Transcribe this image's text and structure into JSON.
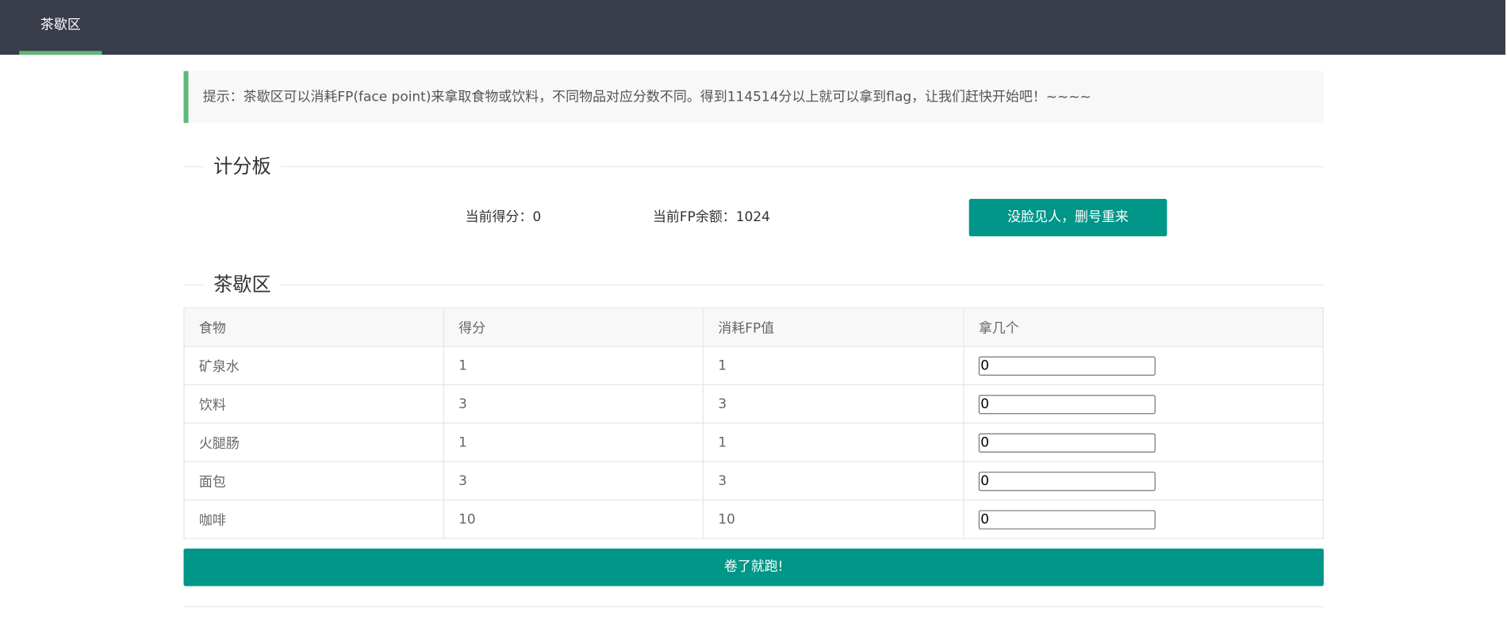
{
  "nav": {
    "active_label": "茶歇区"
  },
  "tip": {
    "text": "提示：茶歇区可以消耗FP(face point)来拿取食物或饮料，不同物品对应分数不同。得到114514分以上就可以拿到flag，让我们赶快开始吧！~~~~"
  },
  "scoreboard": {
    "legend": "计分板",
    "score_label": "当前得分：0",
    "fp_label": "当前FP余额：1024",
    "reset_button": "没脸见人，删号重来"
  },
  "tea": {
    "legend": "茶歇区",
    "headers": [
      "食物",
      "得分",
      "消耗FP值",
      "拿几个"
    ],
    "rows": [
      {
        "name": "矿泉水",
        "score": "1",
        "cost": "1",
        "qty": "0"
      },
      {
        "name": "饮料",
        "score": "3",
        "cost": "3",
        "qty": "0"
      },
      {
        "name": "火腿肠",
        "score": "1",
        "cost": "1",
        "qty": "0"
      },
      {
        "name": "面包",
        "score": "3",
        "cost": "3",
        "qty": "0"
      },
      {
        "name": "咖啡",
        "score": "10",
        "cost": "10",
        "qty": "0"
      }
    ],
    "submit_button": "卷了就跑!"
  },
  "colors": {
    "navbar": "#393d49",
    "accent": "#5fb878",
    "button": "#009688"
  }
}
